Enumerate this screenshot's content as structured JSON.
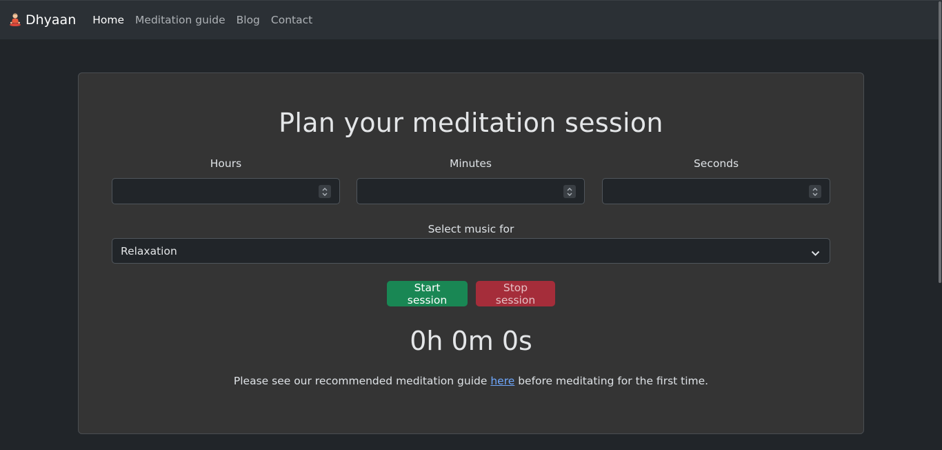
{
  "navbar": {
    "brand": "Dhyaan",
    "brand_icon": "meditating-person-icon",
    "links": [
      {
        "label": "Home",
        "active": true
      },
      {
        "label": "Meditation guide",
        "active": false
      },
      {
        "label": "Blog",
        "active": false
      },
      {
        "label": "Contact",
        "active": false
      }
    ]
  },
  "card": {
    "title": "Plan your meditation session",
    "fields": [
      {
        "label": "Hours",
        "value": ""
      },
      {
        "label": "Minutes",
        "value": ""
      },
      {
        "label": "Seconds",
        "value": ""
      }
    ],
    "select_label": "Select music for",
    "select_value": "Relaxation",
    "start_button": "Start session",
    "stop_button": "Stop session",
    "timer": "0h 0m 0s",
    "note_before": "Please see our recommended meditation guide ",
    "note_link": "here",
    "note_after": " before meditating for the first time."
  },
  "colors": {
    "background": "#212529",
    "card": "#343434",
    "start": "#198754",
    "stop": "#a52d3a",
    "link": "#6ea8fe"
  }
}
